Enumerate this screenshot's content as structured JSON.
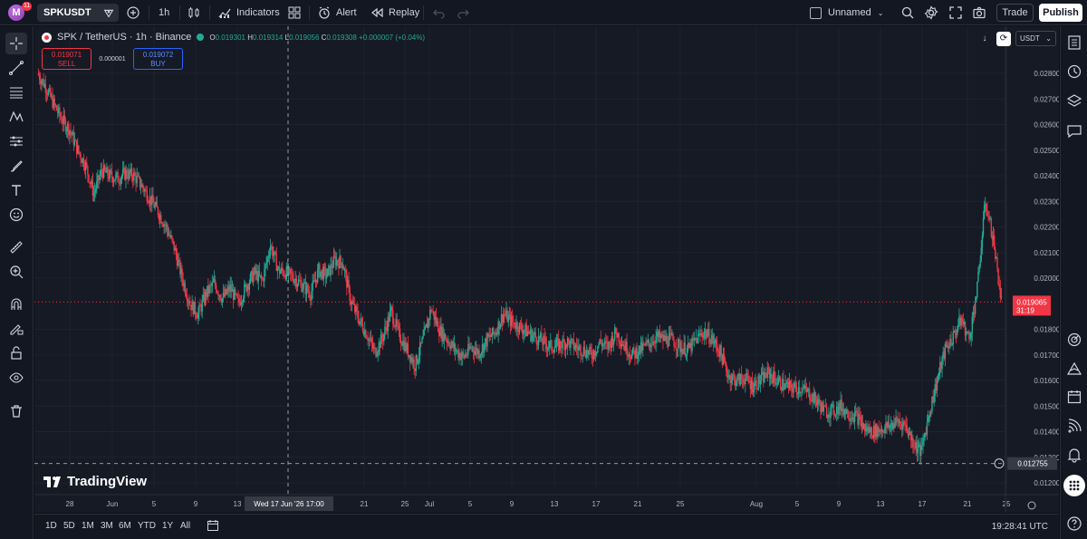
{
  "app": {
    "logo_letter": "M",
    "notification_count": "11"
  },
  "topbar": {
    "symbol": "SPKUSDT",
    "interval": "1h",
    "indicators_label": "Indicators",
    "alert_label": "Alert",
    "replay_label": "Replay",
    "layout_name": "Unnamed",
    "trade_label": "Trade",
    "publish_label": "Publish"
  },
  "legend": {
    "title": "SPK / TetherUS · 1h · Binance",
    "open_key": "O",
    "open": "0.019301",
    "high_key": "H",
    "high": "0.019314",
    "low_key": "L",
    "low": "0.019056",
    "close_key": "C",
    "close": "0.019308",
    "change": "+0.000007 (+0.04%)"
  },
  "trade_widget": {
    "sell_price": "0.019071",
    "sell_label": "SELL",
    "spread": "0.000001",
    "buy_price": "0.019072",
    "buy_label": "BUY"
  },
  "price_scale": {
    "currency": "USDT"
  },
  "watermark": "TradingView",
  "colors": {
    "up": "#22ab94",
    "down": "#f23645",
    "background": "#161a25",
    "grid": "#1f2330"
  },
  "bottombar": {
    "ranges": [
      "1D",
      "5D",
      "1M",
      "3M",
      "6M",
      "YTD",
      "1Y",
      "All"
    ],
    "clock": "19:28:41 UTC"
  },
  "chart_data": {
    "type": "candlestick",
    "y_range": [
      0.0118,
      0.029
    ],
    "y_ticks": [
      "0.028000",
      "0.027000",
      "0.026000",
      "0.025000",
      "0.024000",
      "0.023000",
      "0.022000",
      "0.021000",
      "0.020000",
      "0.018000",
      "0.017000",
      "0.016000",
      "0.015000",
      "0.014000",
      "0.013000",
      "0.012000"
    ],
    "x_ticks": [
      "28",
      "Jun",
      "5",
      "9",
      "13",
      "21",
      "25",
      "Jul",
      "5",
      "9",
      "13",
      "17",
      "21",
      "25",
      "Aug",
      "5",
      "9",
      "13",
      "17",
      "21",
      "25"
    ],
    "crosshair_date": "Wed 17 Jun '26   17:00",
    "last_price": "0.019065",
    "countdown": "31:19",
    "crosshair_price": "0.012755",
    "close_path": [
      [
        0,
        0.028
      ],
      [
        1,
        0.0275
      ],
      [
        2,
        0.0268
      ],
      [
        3,
        0.0262
      ],
      [
        4,
        0.0258
      ],
      [
        5,
        0.025
      ],
      [
        6,
        0.0244
      ],
      [
        7,
        0.0233
      ],
      [
        8,
        0.0242
      ],
      [
        9,
        0.024
      ],
      [
        10,
        0.0239
      ],
      [
        11,
        0.0241
      ],
      [
        12,
        0.024
      ],
      [
        13,
        0.0236
      ],
      [
        14,
        0.0231
      ],
      [
        15,
        0.0226
      ],
      [
        16,
        0.022
      ],
      [
        17,
        0.0212
      ],
      [
        18,
        0.02
      ],
      [
        19,
        0.019
      ],
      [
        20,
        0.0186
      ],
      [
        21,
        0.0194
      ],
      [
        22,
        0.0198
      ],
      [
        23,
        0.0192
      ],
      [
        24,
        0.0196
      ],
      [
        25,
        0.019
      ],
      [
        26,
        0.0197
      ],
      [
        27,
        0.0202
      ],
      [
        28,
        0.0199
      ],
      [
        29,
        0.0213
      ],
      [
        30,
        0.0203
      ],
      [
        31,
        0.0202
      ],
      [
        32,
        0.02
      ],
      [
        33,
        0.0197
      ],
      [
        34,
        0.0194
      ],
      [
        35,
        0.0203
      ],
      [
        36,
        0.0201
      ],
      [
        37,
        0.0207
      ],
      [
        38,
        0.0206
      ],
      [
        39,
        0.0191
      ],
      [
        40,
        0.0184
      ],
      [
        41,
        0.0178
      ],
      [
        42,
        0.0171
      ],
      [
        43,
        0.0177
      ],
      [
        44,
        0.0187
      ],
      [
        45,
        0.0178
      ],
      [
        46,
        0.0172
      ],
      [
        47,
        0.0166
      ],
      [
        48,
        0.0176
      ],
      [
        49,
        0.0188
      ],
      [
        50,
        0.018
      ],
      [
        51,
        0.0176
      ],
      [
        52,
        0.0172
      ],
      [
        53,
        0.0169
      ],
      [
        54,
        0.0173
      ],
      [
        55,
        0.0171
      ],
      [
        56,
        0.0176
      ],
      [
        57,
        0.0179
      ],
      [
        58,
        0.0186
      ],
      [
        59,
        0.0183
      ],
      [
        60,
        0.0181
      ],
      [
        61,
        0.0179
      ],
      [
        62,
        0.0177
      ],
      [
        63,
        0.0175
      ],
      [
        64,
        0.0173
      ],
      [
        65,
        0.0174
      ],
      [
        66,
        0.0175
      ],
      [
        67,
        0.0173
      ],
      [
        68,
        0.0172
      ],
      [
        69,
        0.017
      ],
      [
        70,
        0.0175
      ],
      [
        71,
        0.0173
      ],
      [
        72,
        0.0179
      ],
      [
        73,
        0.0174
      ],
      [
        74,
        0.017
      ],
      [
        75,
        0.0172
      ],
      [
        76,
        0.0174
      ],
      [
        77,
        0.0177
      ],
      [
        78,
        0.0176
      ],
      [
        79,
        0.0176
      ],
      [
        80,
        0.0173
      ],
      [
        81,
        0.0172
      ],
      [
        82,
        0.0176
      ],
      [
        83,
        0.0179
      ],
      [
        84,
        0.0176
      ],
      [
        85,
        0.0171
      ],
      [
        86,
        0.0162
      ],
      [
        87,
        0.016
      ],
      [
        88,
        0.0161
      ],
      [
        89,
        0.0158
      ],
      [
        90,
        0.016
      ],
      [
        91,
        0.0163
      ],
      [
        92,
        0.016
      ],
      [
        93,
        0.0158
      ],
      [
        94,
        0.0157
      ],
      [
        95,
        0.0157
      ],
      [
        96,
        0.0155
      ],
      [
        97,
        0.0152
      ],
      [
        98,
        0.0148
      ],
      [
        99,
        0.0148
      ],
      [
        100,
        0.015
      ],
      [
        101,
        0.0147
      ],
      [
        102,
        0.0146
      ],
      [
        103,
        0.0141
      ],
      [
        104,
        0.014
      ],
      [
        105,
        0.0141
      ],
      [
        106,
        0.0142
      ],
      [
        107,
        0.0144
      ],
      [
        108,
        0.0143
      ],
      [
        109,
        0.0136
      ],
      [
        110,
        0.0132
      ],
      [
        111,
        0.0147
      ],
      [
        112,
        0.016
      ],
      [
        113,
        0.0172
      ],
      [
        114,
        0.0177
      ],
      [
        115,
        0.0184
      ],
      [
        116,
        0.0176
      ],
      [
        117,
        0.0196
      ],
      [
        118,
        0.023
      ],
      [
        119,
        0.0215
      ],
      [
        120,
        0.0191
      ]
    ]
  }
}
